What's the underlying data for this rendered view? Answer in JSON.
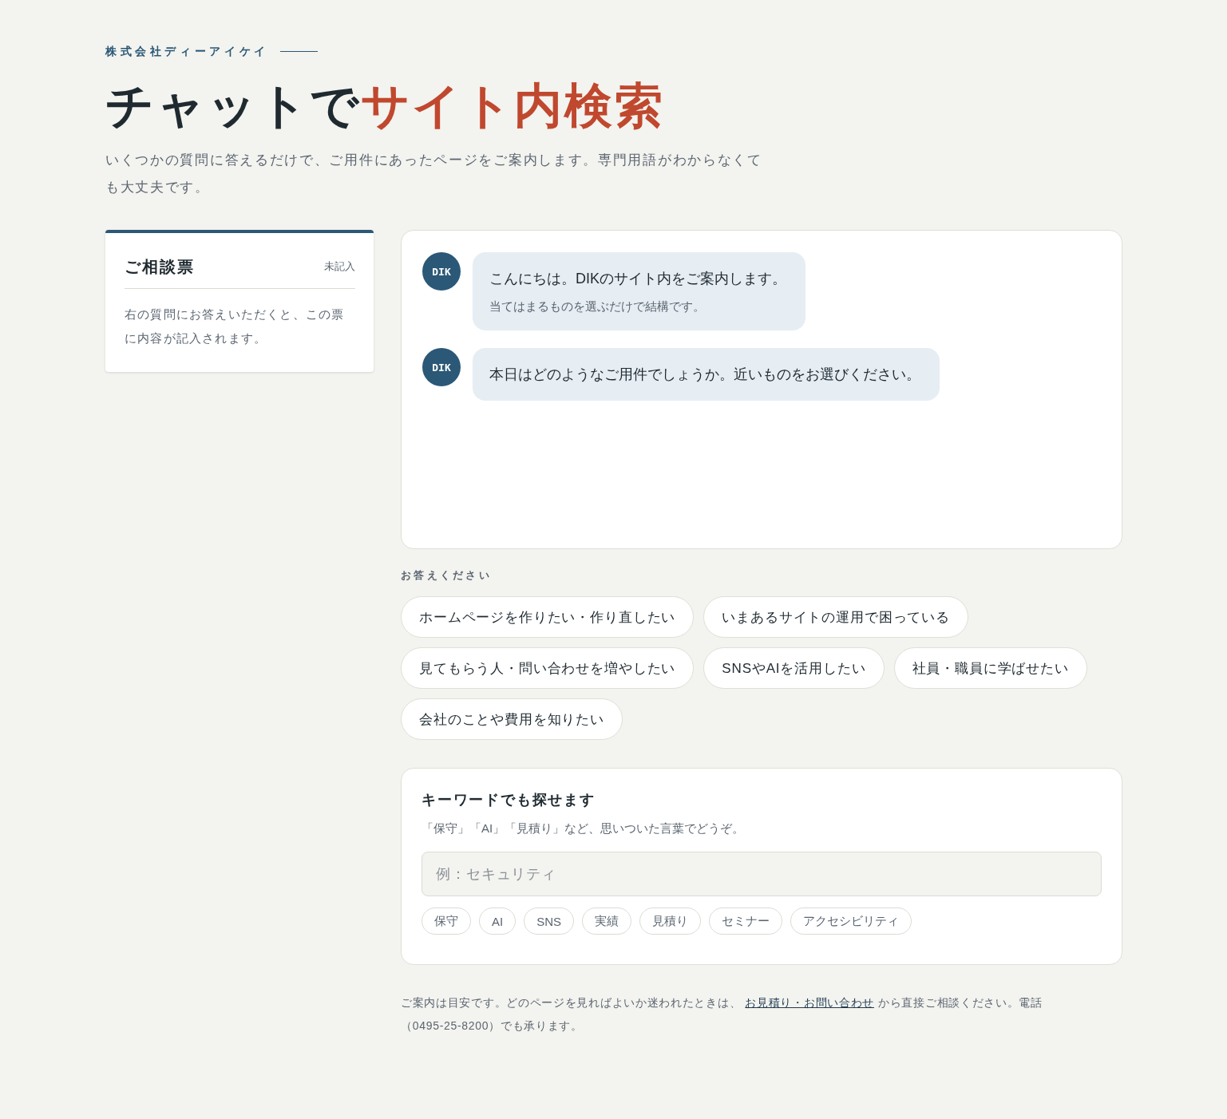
{
  "header": {
    "company": "株式会社ディーアイケイ",
    "title": {
      "text": "チャットで",
      "accent": "サイト内検索"
    },
    "lead": "いくつかの質問に答えるだけで、ご用件にあったページをご案内します。専門用語がわからなくても大丈夫です。"
  },
  "ticket": {
    "title": "ご相談票",
    "status": "未記入",
    "note": "右の質問にお答えいただくと、この票に内容が記入されます。"
  },
  "chat": {
    "messages": [
      {
        "avatar": "DIK",
        "text": "こんにちは。DIKのサイト内をご案内します。",
        "subtext": "当てはまるものを選ぶだけで結構です。"
      },
      {
        "avatar": "DIK",
        "text": "本日はどのようなご用件でしょうか。近いものをお選びください。"
      }
    ]
  },
  "answers": {
    "label": "お答えください",
    "choices": [
      "ホームページを作りたい・作り直したい",
      "いまあるサイトの運用で困っている",
      "見てもらう人・問い合わせを増やしたい",
      "SNSやAIを活用したい",
      "社員・職員に学ばせたい",
      "会社のことや費用を知りたい"
    ]
  },
  "keyword": {
    "title": "キーワードでも探せます",
    "hint": "「保守」「AI」「見積り」など、思いついた言葉でどうぞ。",
    "search": {
      "placeholder": "例：セキュリティ"
    },
    "tags": [
      "保守",
      "AI",
      "SNS",
      "実績",
      "見積り",
      "セミナー",
      "アクセシビリティ"
    ]
  },
  "footer": {
    "before": "ご案内は目安です。どのページを見ればよいか迷われたときは、",
    "link": "お見積り・お問い合わせ",
    "after": "から直接ご相談ください。電話（0495-25-8200）でも承ります。"
  }
}
